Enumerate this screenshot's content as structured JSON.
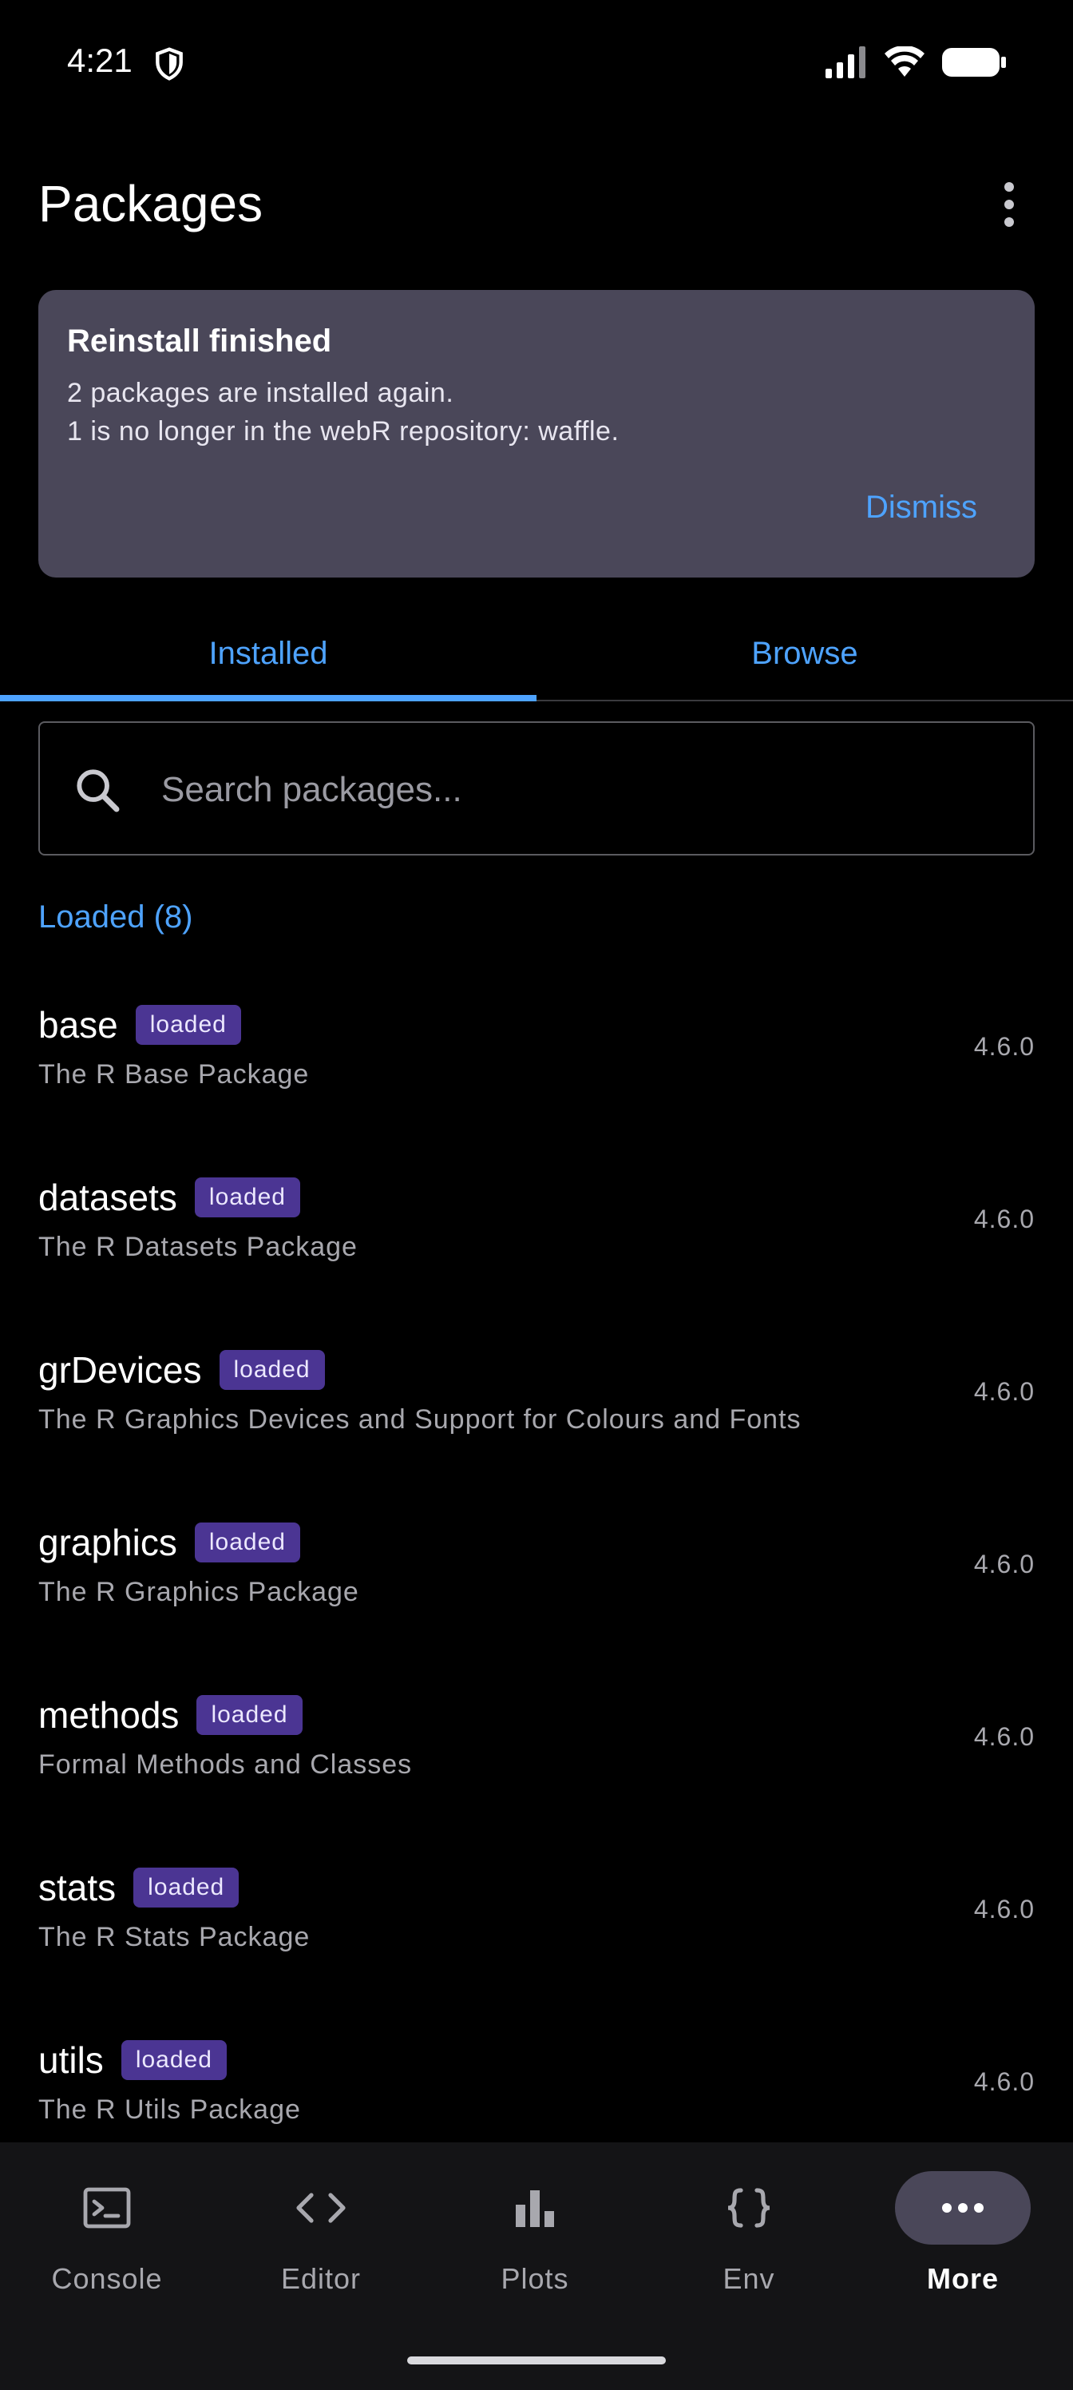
{
  "status_bar": {
    "time": "4:21"
  },
  "header": {
    "title": "Packages"
  },
  "banner": {
    "title": "Reinstall finished",
    "line1": "2 packages are installed again.",
    "line2": "1 is no longer in the webR repository: waffle.",
    "dismiss_label": "Dismiss"
  },
  "tabs": [
    {
      "label": "Installed",
      "selected": true
    },
    {
      "label": "Browse",
      "selected": false
    }
  ],
  "search": {
    "placeholder": "Search packages...",
    "value": ""
  },
  "section": {
    "title": "Loaded (8)"
  },
  "packages": [
    {
      "name": "base",
      "badge": "loaded",
      "description": "The R Base Package",
      "version": "4.6.0"
    },
    {
      "name": "datasets",
      "badge": "loaded",
      "description": "The R Datasets Package",
      "version": "4.6.0"
    },
    {
      "name": "grDevices",
      "badge": "loaded",
      "description": "The R Graphics Devices and Support for Colours and Fonts",
      "version": "4.6.0"
    },
    {
      "name": "graphics",
      "badge": "loaded",
      "description": "The R Graphics Package",
      "version": "4.6.0"
    },
    {
      "name": "methods",
      "badge": "loaded",
      "description": "Formal Methods and Classes",
      "version": "4.6.0"
    },
    {
      "name": "stats",
      "badge": "loaded",
      "description": "The R Stats Package",
      "version": "4.6.0"
    },
    {
      "name": "utils",
      "badge": "loaded",
      "description": "The R Utils Package",
      "version": "4.6.0"
    }
  ],
  "bottom_nav": [
    {
      "label": "Console",
      "icon": "terminal-icon",
      "active": false
    },
    {
      "label": "Editor",
      "icon": "code-icon",
      "active": false
    },
    {
      "label": "Plots",
      "icon": "bar-chart-icon",
      "active": false
    },
    {
      "label": "Env",
      "icon": "braces-icon",
      "active": false
    },
    {
      "label": "More",
      "icon": "more-horizontal-icon",
      "active": true
    }
  ],
  "colors": {
    "accent": "#4ea3ff",
    "badge_bg": "#4b3593",
    "banner_bg": "#4a4759",
    "nav_bg": "#141416"
  }
}
